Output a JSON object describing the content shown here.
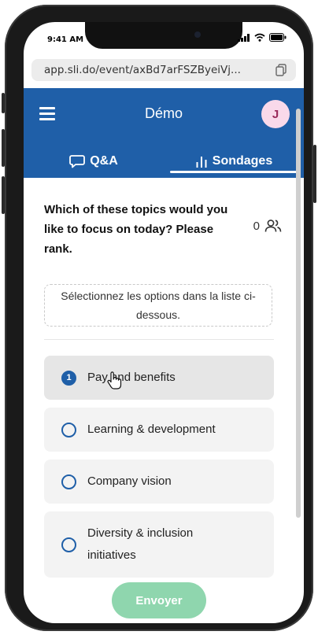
{
  "status_bar": {
    "time": "9:41 AM"
  },
  "browser": {
    "url": "app.sli.do/event/axBd7arFSZByeiVj..."
  },
  "app": {
    "title": "Démo",
    "avatar_initial": "J",
    "tabs": [
      {
        "label": "Q&A",
        "icon": "speech-bubble-icon",
        "active": false
      },
      {
        "label": "Sondages",
        "icon": "bar-chart-icon",
        "active": true
      }
    ]
  },
  "poll": {
    "question": "Which of these topics would you like to focus on today? Please rank.",
    "vote_count": "0",
    "hint": "Sélectionnez les options dans la liste ci-dessous.",
    "options": [
      {
        "label": "Pay and benefits",
        "rank": "1",
        "selected": true
      },
      {
        "label": "Learning & development",
        "selected": false
      },
      {
        "label": "Company vision",
        "selected": false
      },
      {
        "label": "Diversity & inclusion initiatives",
        "selected": false
      }
    ],
    "submit_label": "Envoyer"
  },
  "colors": {
    "primary": "#1f5fa8",
    "submit": "#8fd6ae",
    "avatar_bg": "#f9d9ea",
    "avatar_text": "#9a2a5a"
  }
}
